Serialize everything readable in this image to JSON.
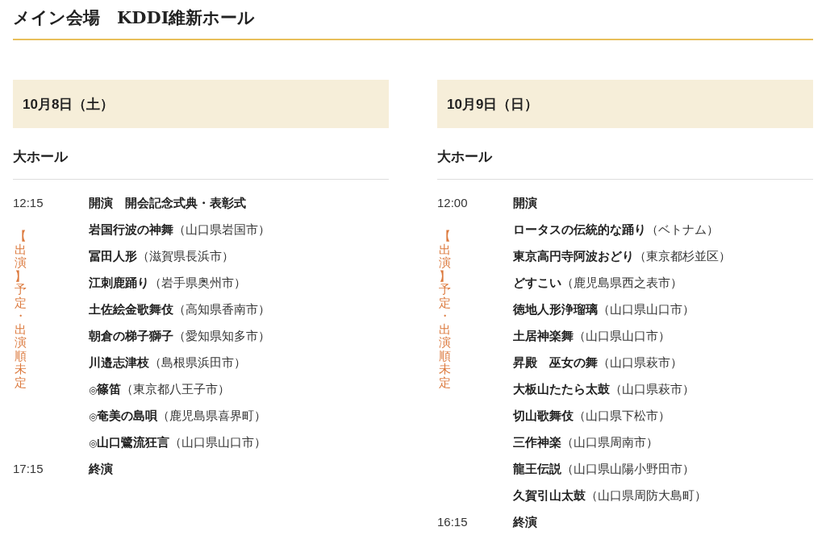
{
  "title": "メイン会場　KDDI維新ホール",
  "days": [
    {
      "date": "10月8日（土）",
      "hall": "大ホール",
      "note": "【出演】予定・出演順未定",
      "rows": [
        {
          "time": "12:15",
          "name": "開演　開会記念式典・表彰式"
        },
        {
          "name": "岩国行波の神舞",
          "place": "（山口県岩国市）"
        },
        {
          "name": "冨田人形",
          "place": "（滋賀県長浜市）"
        },
        {
          "name": "江刺鹿踊り",
          "place": "（岩手県奥州市）"
        },
        {
          "name": "土佐絵金歌舞伎",
          "place": "（高知県香南市）"
        },
        {
          "name": "朝倉の梯子獅子",
          "place": "（愛知県知多市）"
        },
        {
          "name": "川邉志津枝",
          "place": "（島根県浜田市）"
        },
        {
          "mark": "◎",
          "name": "篠笛",
          "place": "（東京都八王子市）"
        },
        {
          "mark": "◎",
          "name": "奄美の島唄",
          "place": "（鹿児島県喜界町）"
        },
        {
          "mark": "◎",
          "name": "山口鷺流狂言",
          "place": "（山口県山口市）"
        },
        {
          "time": "17:15",
          "name": "終演"
        }
      ]
    },
    {
      "date": "10月9日（日）",
      "hall": "大ホール",
      "note": "【出演】予定・出演順未定",
      "rows": [
        {
          "time": "12:00",
          "name": "開演"
        },
        {
          "name": "ロータスの伝統的な踊り",
          "place": "（ベトナム）"
        },
        {
          "name": "東京高円寺阿波おどり",
          "place": "（東京都杉並区）"
        },
        {
          "name": "どすこい",
          "place": "（鹿児島県西之表市）"
        },
        {
          "name": "徳地人形浄瑠璃",
          "place": "（山口県山口市）"
        },
        {
          "name": "土居神楽舞",
          "place": "（山口県山口市）"
        },
        {
          "name": "昇殿　巫女の舞",
          "place": "（山口県萩市）"
        },
        {
          "name": "大板山たたら太鼓",
          "place": "（山口県萩市）"
        },
        {
          "name": "切山歌舞伎",
          "place": "（山口県下松市）"
        },
        {
          "name": "三作神楽",
          "place": "（山口県周南市）"
        },
        {
          "name": "龍王伝説",
          "place": "（山口県山陽小野田市）"
        },
        {
          "name": "久賀引山太鼓",
          "place": "（山口県周防大島町）"
        },
        {
          "time": "16:15",
          "name": "終演"
        }
      ]
    }
  ]
}
